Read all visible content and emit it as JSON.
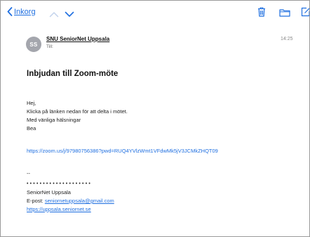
{
  "toolbar": {
    "back_label": "Inkorg"
  },
  "message": {
    "avatar_initials": "SS",
    "sender": "SNU SeniorNet Uppsala",
    "to_label": "Till:",
    "time": "14:25",
    "subject": "Inbjudan till Zoom-möte",
    "greeting": "Hej,",
    "line1": "Klicka på länken nedan för att delta i mötet.",
    "line2": "Med vänliga hälsningar",
    "line3": "Bea",
    "zoom_link": "https://zoom.us/j/97980756386?pwd=RUQ4YVlzWmt1VFdwMk5jV3JCMkZHQT09",
    "sig_dash": "--",
    "sig_stars": "••••••••••••••••••••",
    "sig_name": "SeniorNet Uppsala",
    "sig_email_label": "E-post: ",
    "sig_email": "seniornetuppsala@gmail.com",
    "sig_url": "https://uppsala.seniornet.se"
  },
  "colors": {
    "accent": "#1f6fe0",
    "avatar": "#a4a6ad"
  },
  "icons": {
    "back": "chevron-left-icon",
    "prev": "chevron-up-icon",
    "next": "chevron-down-icon",
    "trash": "trash-icon",
    "folder": "folder-icon",
    "compose": "compose-icon"
  }
}
